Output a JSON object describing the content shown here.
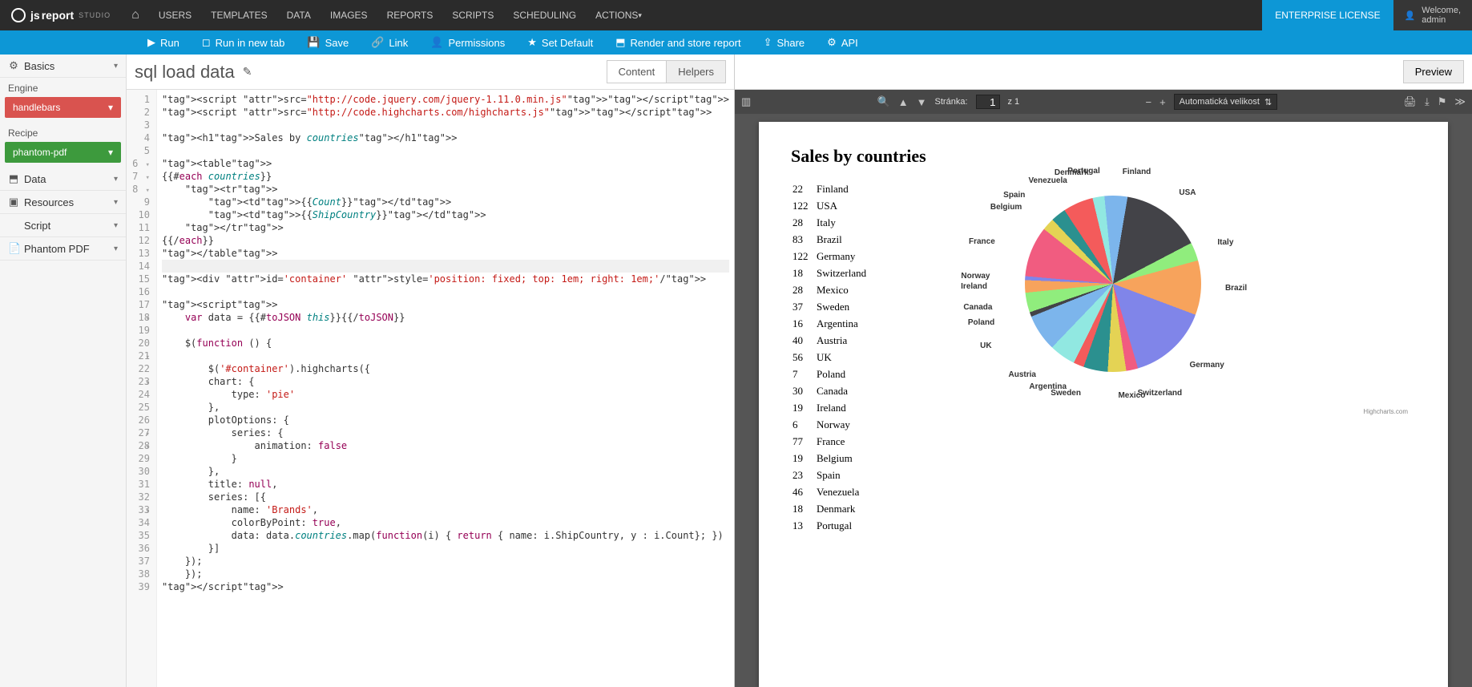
{
  "brand": {
    "prefix": "js",
    "main": "report",
    "suffix": "STUDIO"
  },
  "topnav": [
    "USERS",
    "TEMPLATES",
    "DATA",
    "IMAGES",
    "REPORTS",
    "SCRIPTS",
    "SCHEDULING",
    "ACTIONS"
  ],
  "enterprise_label": "ENTERPRISE LICENSE",
  "welcome": {
    "line1": "Welcome,",
    "line2": "admin"
  },
  "actions": [
    {
      "icon": "play",
      "label": "Run"
    },
    {
      "icon": "window",
      "label": "Run in new tab"
    },
    {
      "icon": "save",
      "label": "Save"
    },
    {
      "icon": "link",
      "label": "Link"
    },
    {
      "icon": "user",
      "label": "Permissions"
    },
    {
      "icon": "star",
      "label": "Set Default"
    },
    {
      "icon": "db",
      "label": "Render and store report"
    },
    {
      "icon": "share",
      "label": "Share"
    },
    {
      "icon": "gear",
      "label": "API"
    }
  ],
  "sidebar": {
    "basics": "Basics",
    "engine_label": "Engine",
    "engine_value": "handlebars",
    "recipe_label": "Recipe",
    "recipe_value": "phantom-pdf",
    "rows": [
      {
        "icon": "db",
        "label": "Data"
      },
      {
        "icon": "box",
        "label": "Resources"
      },
      {
        "icon": "code",
        "label": "Script"
      },
      {
        "icon": "doc",
        "label": "Phantom PDF"
      }
    ]
  },
  "editor": {
    "title": "sql load data",
    "tabs": {
      "content": "Content",
      "helpers": "Helpers"
    },
    "code_lines": [
      "<script src=\"http://code.jquery.com/jquery-1.11.0.min.js\"></script>",
      "<script src=\"http://code.highcharts.com/highcharts.js\"></script>",
      "",
      "<h1>Sales by countries</h1>",
      "",
      "<table>",
      "{{#each countries}}",
      "    <tr>",
      "        <td>{{Count}}</td>",
      "        <td>{{ShipCountry}}</td>",
      "    </tr>",
      "{{/each}}",
      "</table>",
      "",
      "<div id='container' style='position: fixed; top: 1em; right: 1em;'/>",
      "",
      "<script>",
      "    var data = {{#toJSON this}}{{/toJSON}}",
      "",
      "    $(function () {",
      "",
      "        $('#container').highcharts({",
      "        chart: {",
      "            type: 'pie'",
      "        },",
      "        plotOptions: {",
      "            series: {",
      "                animation: false",
      "            }",
      "        },",
      "        title: null,",
      "        series: [{",
      "            name: 'Brands',",
      "            colorByPoint: true,",
      "            data: data.countries.map(function(i) { return { name: i.ShipCountry, y : i.Count}; })",
      "        }]",
      "    });",
      "    });",
      "</script>"
    ]
  },
  "preview_tab": "Preview",
  "pdf_toolbar": {
    "page_label": "Stránka:",
    "page_input": "1",
    "page_total": "z 1",
    "zoom": "Automatická velikost"
  },
  "report": {
    "title": "Sales by countries",
    "credits": "Highcharts.com"
  },
  "chart_data": {
    "type": "pie",
    "title": "Sales by countries",
    "series": [
      {
        "name": "Brands",
        "data": [
          {
            "name": "Finland",
            "value": 22,
            "color": "#7cb5ec"
          },
          {
            "name": "USA",
            "value": 122,
            "color": "#434348"
          },
          {
            "name": "Italy",
            "value": 28,
            "color": "#90ed7d"
          },
          {
            "name": "Brazil",
            "value": 83,
            "color": "#f7a35c"
          },
          {
            "name": "Germany",
            "value": 122,
            "color": "#8085e9"
          },
          {
            "name": "Switzerland",
            "value": 18,
            "color": "#f15c80"
          },
          {
            "name": "Mexico",
            "value": 28,
            "color": "#e4d354"
          },
          {
            "name": "Sweden",
            "value": 37,
            "color": "#2b908f"
          },
          {
            "name": "Argentina",
            "value": 16,
            "color": "#f45b5b"
          },
          {
            "name": "Austria",
            "value": 40,
            "color": "#91e8e1"
          },
          {
            "name": "UK",
            "value": 56,
            "color": "#7cb5ec"
          },
          {
            "name": "Poland",
            "value": 7,
            "color": "#434348"
          },
          {
            "name": "Canada",
            "value": 30,
            "color": "#90ed7d"
          },
          {
            "name": "Ireland",
            "value": 19,
            "color": "#f7a35c"
          },
          {
            "name": "Norway",
            "value": 6,
            "color": "#8085e9"
          },
          {
            "name": "France",
            "value": 77,
            "color": "#f15c80"
          },
          {
            "name": "Belgium",
            "value": 19,
            "color": "#e4d354"
          },
          {
            "name": "Spain",
            "value": 23,
            "color": "#2b908f"
          },
          {
            "name": "Venezuela",
            "value": 46,
            "color": "#f45b5b"
          },
          {
            "name": "Denmark",
            "value": 18,
            "color": "#91e8e1"
          },
          {
            "name": "Portugal",
            "value": 13,
            "color": "#7cb5ec"
          }
        ]
      }
    ]
  }
}
